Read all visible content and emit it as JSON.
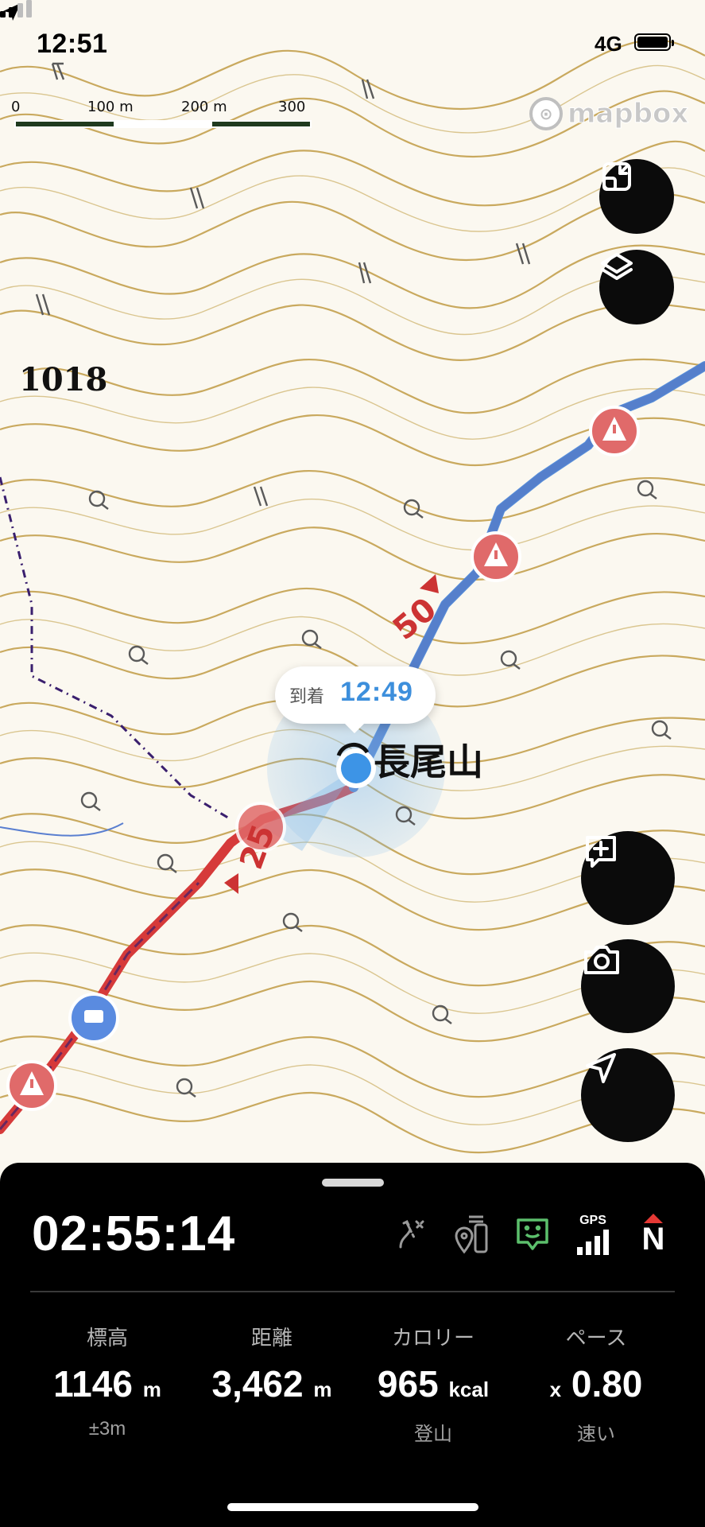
{
  "status_bar": {
    "time": "12:51",
    "network": "4G"
  },
  "map": {
    "scale": {
      "labels": [
        "0",
        "100 m",
        "200 m",
        "300 m"
      ]
    },
    "attribution": "mapbox",
    "elevation_label": "1018",
    "summit_name": "長尾山",
    "route_markers": [
      "25",
      "50"
    ],
    "arrival": {
      "label": "到着",
      "time": "12:49"
    },
    "buttons": {
      "fullscreen": "expand-icon",
      "layers": "layers-icon",
      "add_note": "add-note-icon",
      "camera": "camera-icon",
      "locate": "navigation-icon"
    }
  },
  "panel": {
    "elapsed": "02:55:14",
    "icons": {
      "off_route": "route-off-icon",
      "waypoints": "pins-icon",
      "sharing": "share-face-icon",
      "gps_label": "GPS",
      "compass_label": "N"
    },
    "stats": [
      {
        "label": "標高",
        "value": "1146",
        "unit": "m",
        "sub": "±3m"
      },
      {
        "label": "距離",
        "value": "3,462",
        "unit": "m",
        "sub": ""
      },
      {
        "label": "カロリー",
        "value": "965",
        "unit": "kcal",
        "sub": "登山"
      },
      {
        "label": "ペース",
        "prefix": "x",
        "value": "0.80",
        "unit": "",
        "sub": "速い"
      }
    ]
  },
  "colors": {
    "contour": "#c7a65a",
    "route_red": "#d63a3a",
    "route_blue": "#4a86d8",
    "location_blue": "#3d94e6",
    "accent_green": "#5cbf6c"
  }
}
